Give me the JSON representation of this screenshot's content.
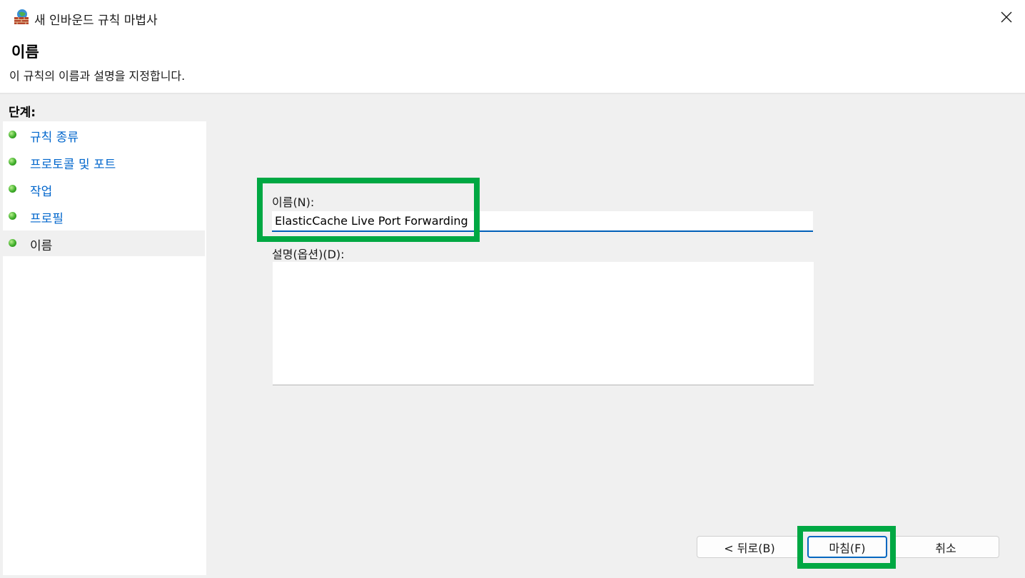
{
  "window": {
    "title": "새 인바운드 규칙 마법사",
    "app_icon": "firewall-wizard-icon",
    "close_icon": "close-icon"
  },
  "header": {
    "title": "이름",
    "description": "이 규칙의 이름과 설명을 지정합니다."
  },
  "steps": {
    "heading": "단계:",
    "items": [
      {
        "label": "규칙 종류",
        "completed": true
      },
      {
        "label": "프로토콜 및 포트",
        "completed": true
      },
      {
        "label": "작업",
        "completed": true
      },
      {
        "label": "프로필",
        "completed": true
      },
      {
        "label": "이름",
        "current": true
      }
    ],
    "status_color": "#3fae2a",
    "link_color": "#0066cc"
  },
  "form": {
    "name_label": "이름(N):",
    "name_value": "ElasticCache Live Port Forwarding",
    "description_label": "설명(옵션)(D):",
    "description_value": ""
  },
  "buttons": {
    "back": "< 뒤로(B)",
    "finish": "마침(F)",
    "cancel": "취소"
  },
  "highlight_color": "#00a843"
}
